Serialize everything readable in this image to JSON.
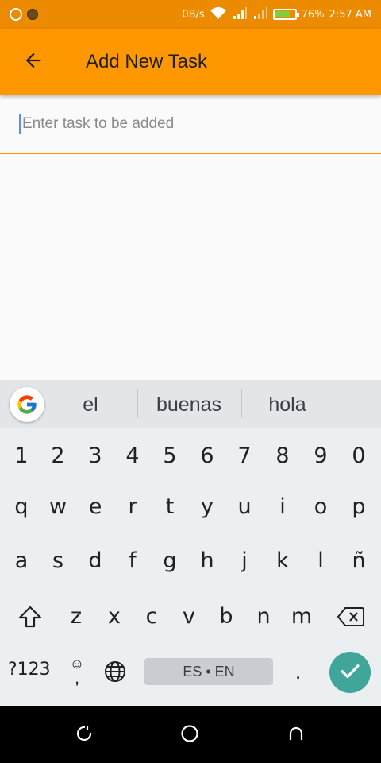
{
  "status_bar": {
    "net_speed": "0B/s",
    "battery_percent": "76%",
    "time": "2:57 AM",
    "battery_level": 0.76,
    "icons": [
      "whatsapp-icon",
      "notification-dot-icon",
      "wifi-icon",
      "signal-icon",
      "signal-2-icon",
      "battery-icon"
    ]
  },
  "app_bar": {
    "title": "Add New Task",
    "back_icon": "arrow-back-icon",
    "color": "#ff9800"
  },
  "task_input": {
    "placeholder": "Enter task to be added",
    "value": ""
  },
  "keyboard": {
    "suggestions": [
      "el",
      "buenas",
      "hola"
    ],
    "number_row": [
      "1",
      "2",
      "3",
      "4",
      "5",
      "6",
      "7",
      "8",
      "9",
      "0"
    ],
    "row1": [
      "q",
      "w",
      "e",
      "r",
      "t",
      "y",
      "u",
      "i",
      "o",
      "p"
    ],
    "row2": [
      "a",
      "s",
      "d",
      "f",
      "g",
      "h",
      "j",
      "k",
      "l",
      "ñ"
    ],
    "row3": [
      "z",
      "x",
      "c",
      "v",
      "b",
      "n",
      "m"
    ],
    "symbols_label": "?123",
    "space_label": "ES • EN",
    "period_label": ".",
    "emoji_top": "☺",
    "emoji_bottom": ",",
    "accent_color": "#40a69a"
  },
  "nav_bar": {
    "icons": [
      "recents-icon",
      "home-icon",
      "back-nav-icon"
    ]
  }
}
